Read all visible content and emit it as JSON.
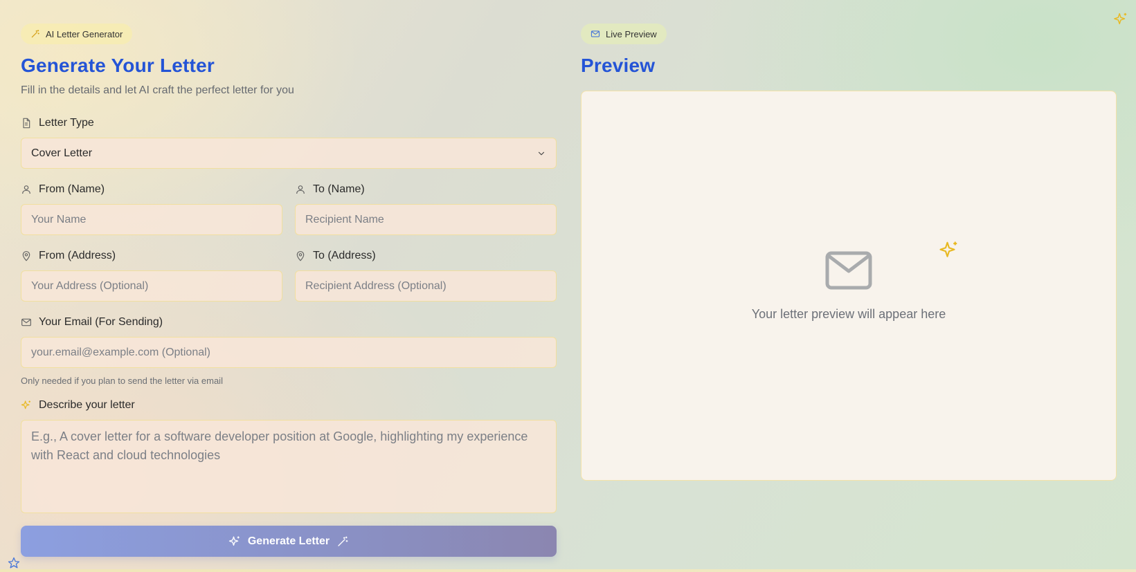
{
  "left": {
    "badge": "AI Letter Generator",
    "title": "Generate Your Letter",
    "subtitle": "Fill in the details and let AI craft the perfect letter for you",
    "letter_type": {
      "label": "Letter Type",
      "value": "Cover Letter"
    },
    "from_name": {
      "label": "From (Name)",
      "placeholder": "Your Name"
    },
    "to_name": {
      "label": "To (Name)",
      "placeholder": "Recipient Name"
    },
    "from_address": {
      "label": "From (Address)",
      "placeholder": "Your Address (Optional)"
    },
    "to_address": {
      "label": "To (Address)",
      "placeholder": "Recipient Address (Optional)"
    },
    "email": {
      "label": "Your Email (For Sending)",
      "placeholder": "your.email@example.com (Optional)",
      "hint": "Only needed if you plan to send the letter via email"
    },
    "describe": {
      "label": "Describe your letter",
      "placeholder": "E.g., A cover letter for a software developer position at Google, highlighting my experience with React and cloud technologies"
    },
    "generate_button": "Generate Letter"
  },
  "right": {
    "badge": "Live Preview",
    "title": "Preview",
    "empty_text": "Your letter preview will appear here"
  },
  "colors": {
    "accent_blue": "#2454d6",
    "sparkle_yellow": "#e8b923",
    "input_bg": "#f7e6d8",
    "input_border": "#f1df9f"
  }
}
